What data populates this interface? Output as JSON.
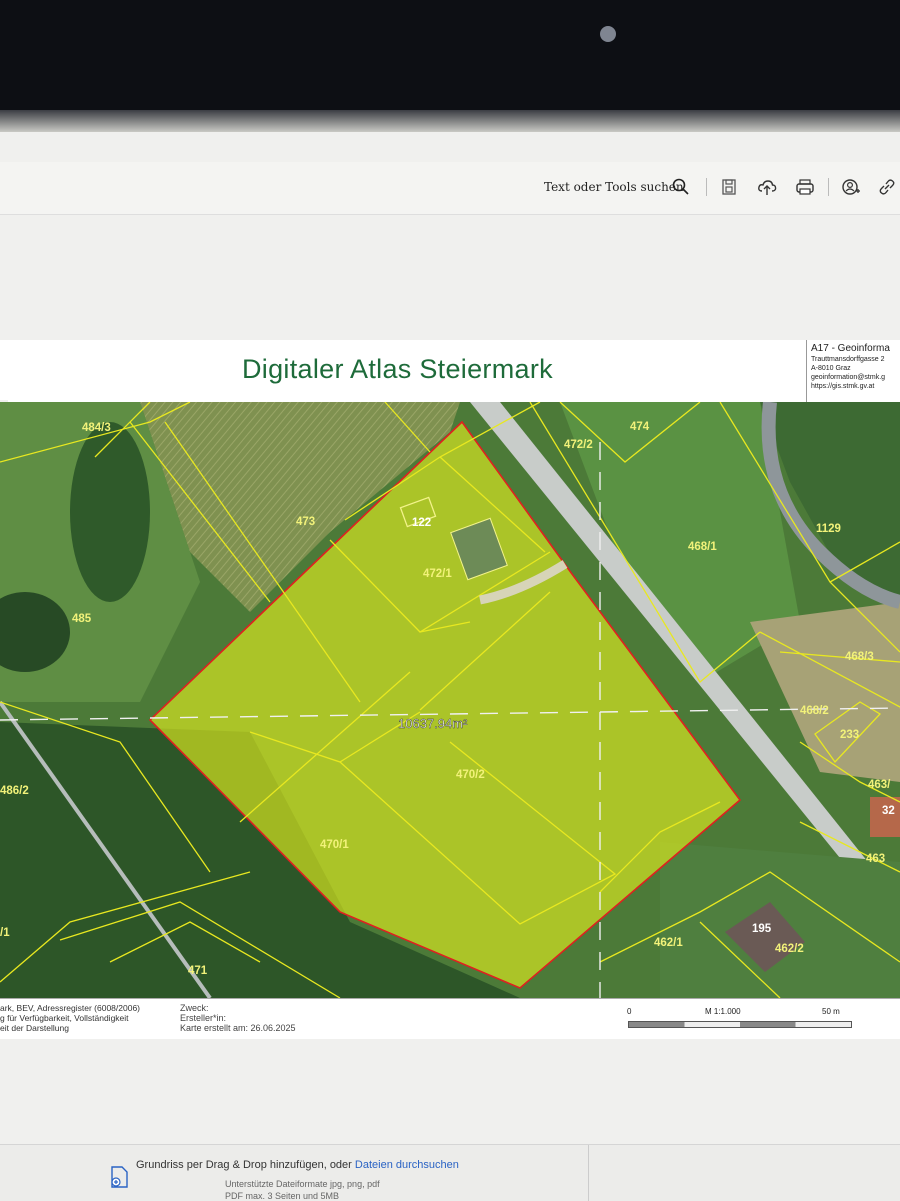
{
  "toolbar": {
    "search_label": "Text oder Tools suchen"
  },
  "sheet": {
    "title": "Digitaler Atlas Steiermark",
    "info": {
      "org": "A17 - Geoinforma",
      "street": "Trauttmansdorffgasse 2",
      "city": "A-8010 Graz",
      "email": "geoinformation@stmk.g",
      "url": "https://gis.stmk.gv.at"
    }
  },
  "map": {
    "area_label": "10637.94m²",
    "parcels": [
      "484/3",
      "473",
      "485",
      "472/2",
      "474",
      "122",
      "472/1",
      "468/1",
      "1129",
      "468/3",
      "468/2",
      "233",
      "470/2",
      "470/1",
      "486/2",
      "463/",
      "32",
      "463",
      "195",
      "462/2",
      "462/1",
      "471",
      "/1"
    ],
    "colors": {
      "boundary": "#e02020",
      "parcel_lines": "#e8e820",
      "highlight_fill": "#d8e820",
      "label": "#f2f27a"
    }
  },
  "footer": {
    "left_lines": [
      "ark, BEV, Adressregister (6008/2006)",
      "g für Verfügbarkeit, Vollständigkeit",
      "eit der Darstellung"
    ],
    "zweck": "Zweck:",
    "ersteller": "Ersteller*in:",
    "erstellt": "Karte erstellt am: 26.06.2025",
    "scale_start": "0",
    "scale_ratio": "M 1:1.000",
    "scale_end": "50 m"
  },
  "upload": {
    "prompt": "Grundriss per Drag & Drop hinzufügen, oder ",
    "link": "Dateien durchsuchen",
    "formats": "Unterstützte Dateiformate jpg, png, pdf",
    "limits": "PDF max. 3 Seiten und 5MB"
  }
}
